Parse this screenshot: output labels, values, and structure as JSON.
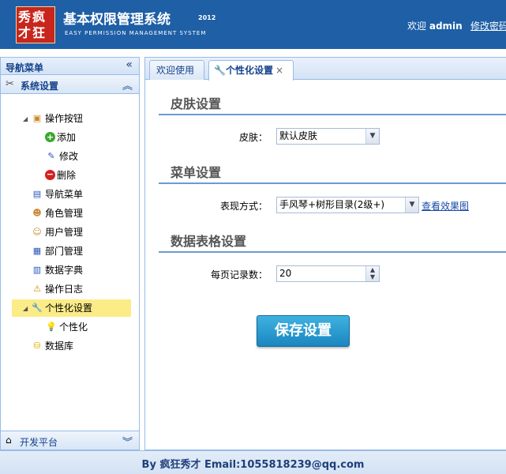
{
  "header": {
    "logo_line1": "秀疯",
    "logo_line2": "才狂",
    "title": "基本权限管理系统",
    "year": "2012",
    "subtitle": "EASY PERMISSION MANAGEMENT SYSTEM",
    "welcome_prefix": "欢迎",
    "username": "admin",
    "change_password": "修改密码"
  },
  "sidebar": {
    "title": "导航菜单",
    "section": "系统设置",
    "items": [
      {
        "label": "操作按钮",
        "icon": "package-icon"
      },
      {
        "label": "添加",
        "icon": "add-icon"
      },
      {
        "label": "修改",
        "icon": "pencil-icon"
      },
      {
        "label": "删除",
        "icon": "delete-icon"
      },
      {
        "label": "导航菜单",
        "icon": "menu-icon"
      },
      {
        "label": "角色管理",
        "icon": "users-icon"
      },
      {
        "label": "用户管理",
        "icon": "user-icon"
      },
      {
        "label": "部门管理",
        "icon": "org-icon"
      },
      {
        "label": "数据字典",
        "icon": "book-icon"
      },
      {
        "label": "操作日志",
        "icon": "warning-icon"
      },
      {
        "label": "个性化设置",
        "icon": "wrench-icon"
      },
      {
        "label": "个性化",
        "icon": "bulb-icon"
      },
      {
        "label": "数据库",
        "icon": "database-icon"
      }
    ],
    "bottom_section": "开发平台"
  },
  "tabs": [
    {
      "label": "欢迎使用"
    },
    {
      "label": "个性化设置",
      "close": "×"
    }
  ],
  "form": {
    "skin_title": "皮肤设置",
    "skin_label": "皮肤：",
    "skin_value": "默认皮肤",
    "menu_title": "菜单设置",
    "menu_label": "表现方式：",
    "menu_value": "手风琴+树形目录(2级+)",
    "preview_link": "查看效果图",
    "grid_title": "数据表格设置",
    "page_size_label": "每页记录数：",
    "page_size_value": "20",
    "save_button": "保存设置"
  },
  "footer": {
    "text": "By 疯狂秀才 Email:1055818239@qq.com"
  },
  "colors": {
    "header_bg": "#1e5fa6",
    "border": "#99bbe8",
    "selected_bg": "#fbec88",
    "save_button": "#1a86c0"
  }
}
